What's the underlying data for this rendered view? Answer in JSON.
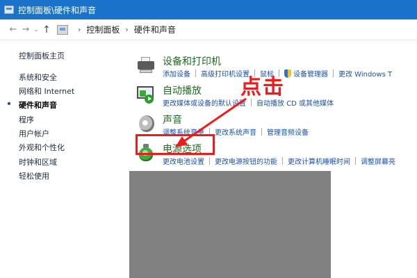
{
  "window": {
    "title": "控制面板\\硬件和声音"
  },
  "nav": {
    "back_glyph": "←",
    "forward_glyph": "→",
    "recent_glyph": "⌄",
    "up_glyph": "↑",
    "sep1": "›",
    "sep2": "›",
    "breadcrumbs": [
      "控制面板",
      "硬件和声音"
    ]
  },
  "sidebar": {
    "items": [
      {
        "label": "控制面板主页",
        "active": false
      },
      {
        "label": "系统和安全",
        "active": false
      },
      {
        "label": "网络和 Internet",
        "active": false
      },
      {
        "label": "硬件和声音",
        "active": true
      },
      {
        "label": "程序",
        "active": false
      },
      {
        "label": "用户帐户",
        "active": false
      },
      {
        "label": "外观和个性化",
        "active": false
      },
      {
        "label": "时钟和区域",
        "active": false
      },
      {
        "label": "轻松使用",
        "active": false
      }
    ]
  },
  "categories": [
    {
      "title": "设备和打印机",
      "icon": "printer-icon",
      "links": [
        "添加设备",
        "高级打印机设置",
        "鼠标",
        "设备管理器",
        "更改 Windows T"
      ]
    },
    {
      "title": "自动播放",
      "icon": "autoplay-icon",
      "links": [
        "更改媒体或设备的默认设置",
        "自动播放 CD 或其他媒体"
      ]
    },
    {
      "title": "声音",
      "icon": "speaker-icon",
      "links": [
        "调整系统音量",
        "更改系统声音",
        "管理音频设备"
      ]
    },
    {
      "title": "电源选项",
      "icon": "power-icon",
      "links": [
        "更改电池设置",
        "更改电源按钮的功能",
        "更改计算机睡眠时间",
        "调整屏幕亮"
      ]
    }
  ],
  "annotation": {
    "text": "点击",
    "color": "#ec1c1c"
  },
  "colors": {
    "titlebar": "#1a73c8",
    "category_title": "#1e6b1e",
    "link": "#1a50a8",
    "redaction": "#818181"
  }
}
